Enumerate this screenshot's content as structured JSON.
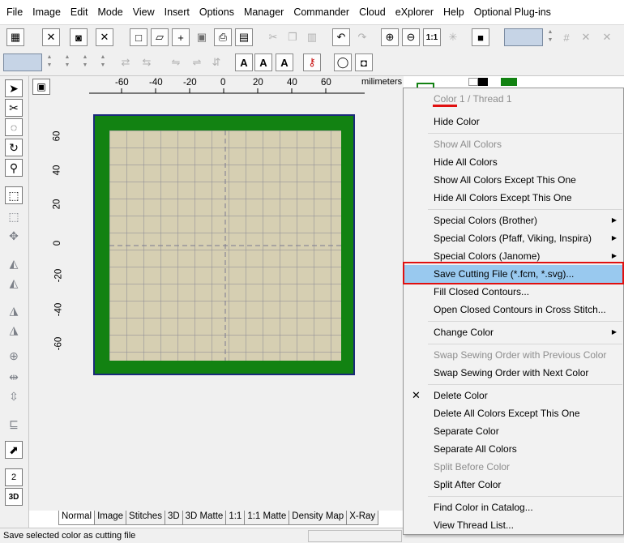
{
  "menubar": [
    "File",
    "Image",
    "Edit",
    "Mode",
    "View",
    "Insert",
    "Options",
    "Manager",
    "Commander",
    "Cloud",
    "eXplorer",
    "Help",
    "Optional Plug-ins"
  ],
  "ruler": {
    "top_ticks": [
      "-60",
      "-40",
      "-20",
      "0",
      "20",
      "40",
      "60"
    ],
    "left_ticks": [
      "60",
      "40",
      "20",
      "0",
      "-20",
      "-40",
      "-60"
    ],
    "unit": "milimeters"
  },
  "tabs": [
    "Normal",
    "Image",
    "Stitches",
    "3D",
    "3D Matte",
    "1:1",
    "1:1 Matte",
    "Density Map",
    "X-Ray"
  ],
  "status": "Save selected color as cutting file",
  "colors": {
    "hoop": "#1a2a7a",
    "border": "#128212",
    "fabric": "#d6cfb2",
    "highlight": "#99c9ef",
    "callout": "#e01010"
  },
  "context_menu": {
    "header": "Color 1 / Thread 1",
    "items": [
      "Hide Color",
      "Show All Colors",
      "Hide All Colors",
      "Show All Colors Except This One",
      "Hide All Colors Except This One",
      "Special Colors (Brother)",
      "Special Colors (Pfaff, Viking, Inspira)",
      "Special Colors (Janome)",
      "Save Cutting File (*.fcm, *.svg)...",
      "Fill Closed Contours...",
      "Open Closed Contours in Cross Stitch...",
      "Change Color",
      "Swap Sewing Order with Previous Color",
      "Swap Sewing Order with Next Color",
      "Delete Color",
      "Delete All Colors Except This One",
      "Separate Color",
      "Separate All Colors",
      "Split Before Color",
      "Split After Color",
      "Find Color in Catalog...",
      "View Thread List..."
    ]
  }
}
